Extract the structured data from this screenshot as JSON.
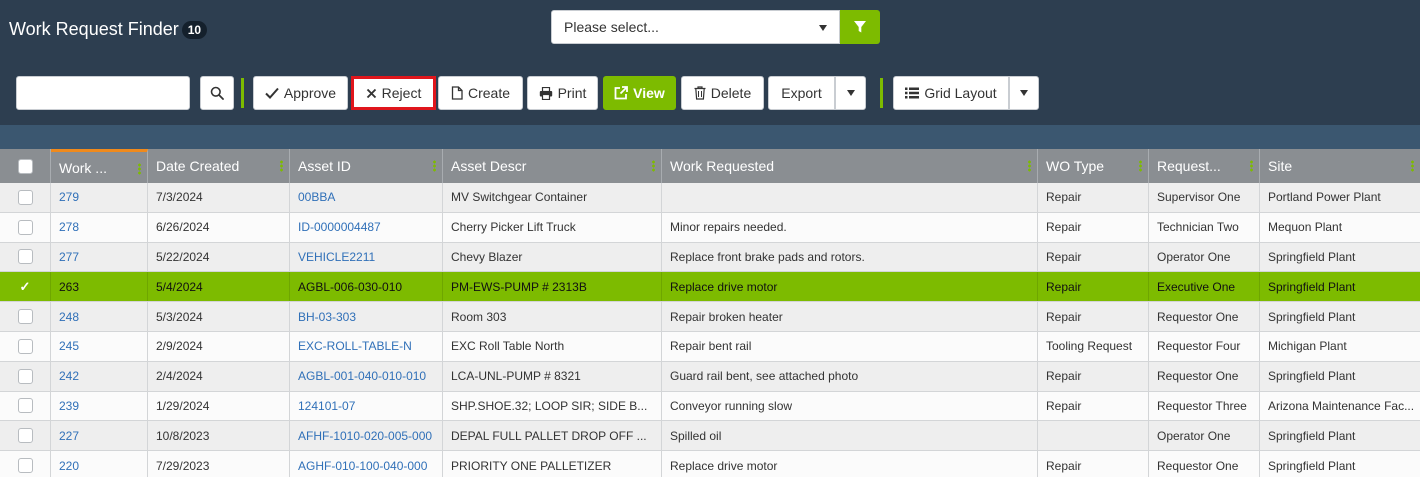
{
  "header": {
    "title": "Work Request Finder",
    "count": "10",
    "select_placeholder": "Please select..."
  },
  "toolbar": {
    "search_placeholder": "",
    "approve": "Approve",
    "reject": "Reject",
    "create": "Create",
    "print": "Print",
    "view": "View",
    "delete": "Delete",
    "export": "Export",
    "grid_layout": "Grid Layout"
  },
  "colors": {
    "accent": "#7dbb00",
    "highlight_border": "#e0161c",
    "background": "#2d3e50",
    "link": "#3070b8"
  },
  "icons": {
    "search": "search-icon",
    "filter": "filter-icon",
    "approve": "check-icon",
    "reject": "x-icon",
    "create": "file-icon",
    "print": "printer-icon",
    "view": "external-link-icon",
    "delete": "trash-icon",
    "grid_layout": "list-icon"
  },
  "grid": {
    "columns": [
      "Work ...",
      "Date Created",
      "Asset ID",
      "Asset Descr",
      "Work Requested",
      "WO Type",
      "Request...",
      "Site"
    ],
    "rows": [
      {
        "work": "279",
        "date": "7/3/2024",
        "asset_id": "00BBA",
        "asset_descr": "MV Switchgear Container",
        "work_requested": "",
        "wo_type": "Repair",
        "requestor": "Supervisor One",
        "site": "Portland Power Plant",
        "selected": false
      },
      {
        "work": "278",
        "date": "6/26/2024",
        "asset_id": "ID-0000004487",
        "asset_descr": "Cherry Picker Lift Truck",
        "work_requested": "Minor repairs needed.",
        "wo_type": "Repair",
        "requestor": "Technician Two",
        "site": "Mequon Plant",
        "selected": false
      },
      {
        "work": "277",
        "date": "5/22/2024",
        "asset_id": "VEHICLE2211",
        "asset_descr": "Chevy Blazer",
        "work_requested": "Replace front brake pads and rotors.",
        "wo_type": "Repair",
        "requestor": "Operator One",
        "site": "Springfield Plant",
        "selected": false
      },
      {
        "work": "263",
        "date": "5/4/2024",
        "asset_id": "AGBL-006-030-010",
        "asset_descr": "PM-EWS-PUMP # 2313B",
        "work_requested": "Replace drive motor",
        "wo_type": "Repair",
        "requestor": "Executive One",
        "site": "Springfield Plant",
        "selected": true
      },
      {
        "work": "248",
        "date": "5/3/2024",
        "asset_id": "BH-03-303",
        "asset_descr": "Room 303",
        "work_requested": "Repair broken heater",
        "wo_type": "Repair",
        "requestor": "Requestor One",
        "site": "Springfield Plant",
        "selected": false
      },
      {
        "work": "245",
        "date": "2/9/2024",
        "asset_id": "EXC-ROLL-TABLE-N",
        "asset_descr": "EXC Roll Table North",
        "work_requested": "Repair bent rail",
        "wo_type": "Tooling Request",
        "requestor": "Requestor Four",
        "site": "Michigan Plant",
        "selected": false
      },
      {
        "work": "242",
        "date": "2/4/2024",
        "asset_id": "AGBL-001-040-010-010",
        "asset_descr": "LCA-UNL-PUMP # 8321",
        "work_requested": "Guard rail bent, see attached photo",
        "wo_type": "Repair",
        "requestor": "Requestor One",
        "site": "Springfield Plant",
        "selected": false
      },
      {
        "work": "239",
        "date": "1/29/2024",
        "asset_id": "124101-07",
        "asset_descr": "SHP.SHOE.32; LOOP SIR; SIDE B...",
        "work_requested": "Conveyor running slow",
        "wo_type": "Repair",
        "requestor": "Requestor Three",
        "site": "Arizona Maintenance Fac...",
        "selected": false
      },
      {
        "work": "227",
        "date": "10/8/2023",
        "asset_id": "AFHF-1010-020-005-000",
        "asset_descr": "DEPAL FULL PALLET DROP OFF ...",
        "work_requested": "Spilled oil",
        "wo_type": "",
        "requestor": "Operator One",
        "site": "Springfield Plant",
        "selected": false
      },
      {
        "work": "220",
        "date": "7/29/2023",
        "asset_id": "AGHF-010-100-040-000",
        "asset_descr": "PRIORITY ONE PALLETIZER",
        "work_requested": "Replace drive motor",
        "wo_type": "Repair",
        "requestor": "Requestor One",
        "site": "Springfield Plant",
        "selected": false
      }
    ]
  }
}
